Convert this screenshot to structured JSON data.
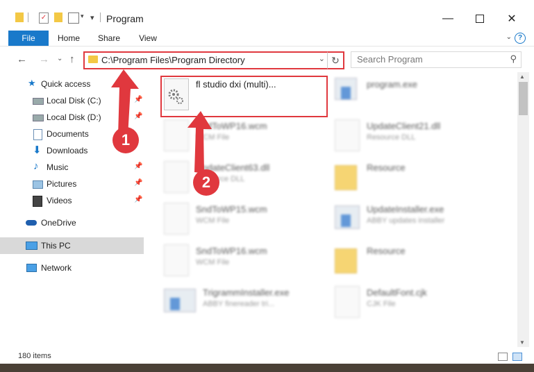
{
  "window": {
    "title": "Program"
  },
  "tabs": {
    "file": "File",
    "home": "Home",
    "share": "Share",
    "view": "View"
  },
  "address": {
    "path": "C:\\Program Files\\Program Directory"
  },
  "search": {
    "placeholder": "Search Program"
  },
  "nav": {
    "quick_access": "Quick access",
    "items": [
      {
        "label": "Local Disk (C:)"
      },
      {
        "label": "Local Disk (D:)"
      },
      {
        "label": "Documents"
      },
      {
        "label": "Downloads"
      },
      {
        "label": "Music"
      },
      {
        "label": "Pictures"
      },
      {
        "label": "Videos"
      }
    ],
    "onedrive": "OneDrive",
    "thispc": "This PC",
    "network": "Network"
  },
  "highlighted_file": {
    "name": "fl studio dxi (multi)..."
  },
  "files": [
    {
      "name": "program.exe",
      "type": ""
    },
    {
      "name": "SndToWP16.wcm",
      "type": "WCM File"
    },
    {
      "name": "UpdateClient21.dll",
      "type": "Resource DLL"
    },
    {
      "name": "UpdateClient63.dll",
      "type": "Resource DLL"
    },
    {
      "name": "Resource",
      "type": ""
    },
    {
      "name": "SndToWP15.wcm",
      "type": "WCM File"
    },
    {
      "name": "UpdateInstaller.exe",
      "type": "ABBY updates installer"
    },
    {
      "name": "SndToWP16.wcm",
      "type": "WCM File"
    },
    {
      "name": "Resource",
      "type": ""
    },
    {
      "name": "TrigrammInstaller.exe",
      "type": "ABBY finereader tri..."
    },
    {
      "name": "DefaultFont.cjk",
      "type": "CJK File"
    }
  ],
  "status": {
    "count": "180 items"
  },
  "markers": {
    "one": "1",
    "two": "2"
  },
  "colors": {
    "accent": "#1979ca",
    "highlight": "#e0383e",
    "folder": "#f3c845"
  }
}
